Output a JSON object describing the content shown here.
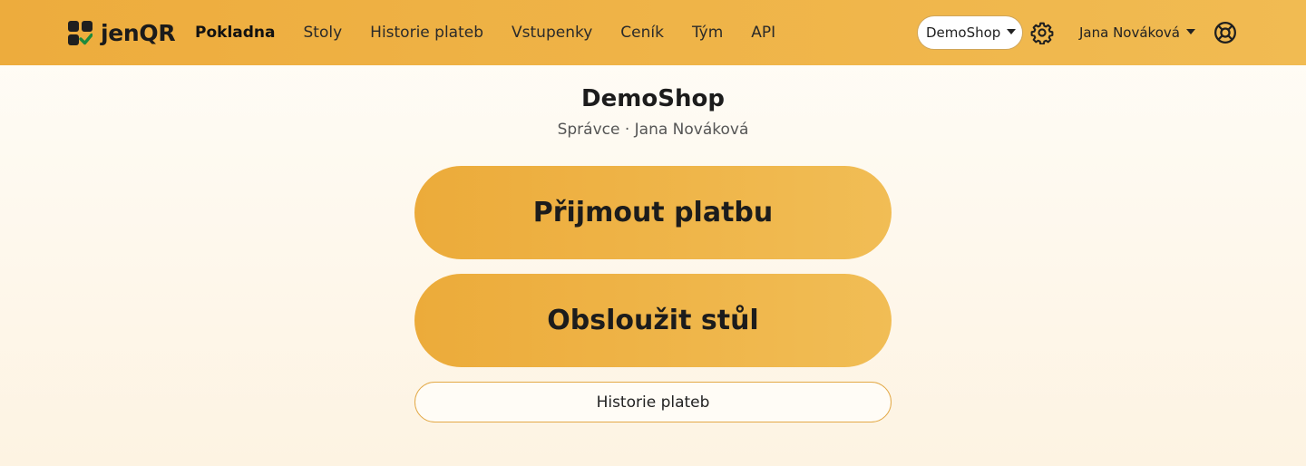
{
  "brand": {
    "name": "jenQR",
    "logo_icon": "qr-check-logo-icon"
  },
  "nav": {
    "items": [
      {
        "label": "Pokladna",
        "active": true
      },
      {
        "label": "Stoly",
        "active": false
      },
      {
        "label": "Historie plateb",
        "active": false
      },
      {
        "label": "Vstupenky",
        "active": false
      },
      {
        "label": "Ceník",
        "active": false
      },
      {
        "label": "Tým",
        "active": false
      },
      {
        "label": "API",
        "active": false
      }
    ]
  },
  "header": {
    "shop_selector": {
      "selected": "DemoShop"
    },
    "settings_icon": "gear-icon",
    "user": {
      "name": "Jana Nováková"
    },
    "help_icon": "lifebuoy-icon"
  },
  "main": {
    "title": "DemoShop",
    "subtitle": "Správce · Jana Nováková",
    "primary_action": "Přijmout platbu",
    "secondary_action": "Obsloužit stůl",
    "history_action": "Historie plateb"
  },
  "colors": {
    "accent": "#EEB043",
    "background": "#FEF8EC",
    "text": "#1F1F1F"
  }
}
